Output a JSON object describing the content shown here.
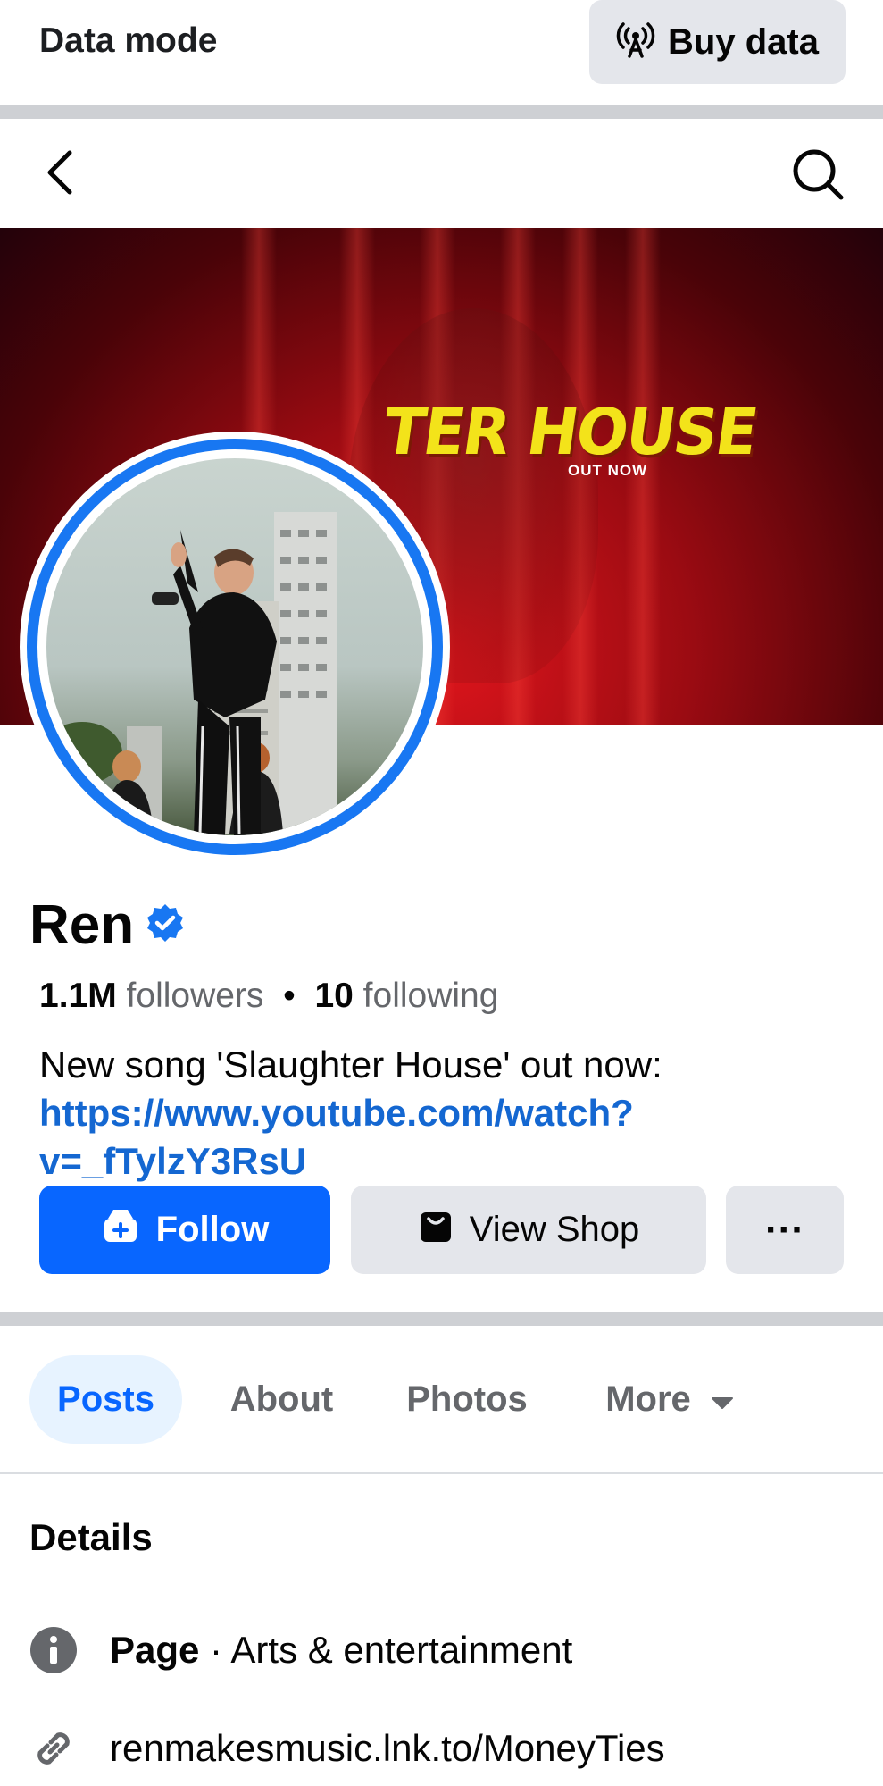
{
  "data_mode": {
    "label": "Data mode",
    "buy_data_label": "Buy data"
  },
  "nav": {
    "back_icon": "back-chevron-icon",
    "search_icon": "search-icon"
  },
  "cover": {
    "title_text": "TER HOUSE",
    "subtitle_text": "OUT NOW"
  },
  "profile": {
    "name": "Ren",
    "verified": true,
    "followers_count": "1.1M",
    "followers_label": "followers",
    "separator": "•",
    "following_count": "10",
    "following_label": "following",
    "bio_text": "New song 'Slaughter House' out now: ",
    "bio_link": "https://www.youtube.com/watch?v=_fTylzY3RsU"
  },
  "actions": {
    "follow_label": "Follow",
    "view_shop_label": "View Shop",
    "more_label": "···"
  },
  "tabs": [
    {
      "label": "Posts",
      "active": true
    },
    {
      "label": "About",
      "active": false
    },
    {
      "label": "Photos",
      "active": false
    },
    {
      "label": "More",
      "active": false
    }
  ],
  "details": {
    "title": "Details",
    "page_label": "Page",
    "page_category": " · Arts & entertainment",
    "link": "renmakesmusic.lnk.to/MoneyTies"
  },
  "colors": {
    "accent": "#0866ff",
    "link": "#1467d1",
    "secondary_text": "#65676b",
    "button_gray": "#e4e6eb"
  }
}
